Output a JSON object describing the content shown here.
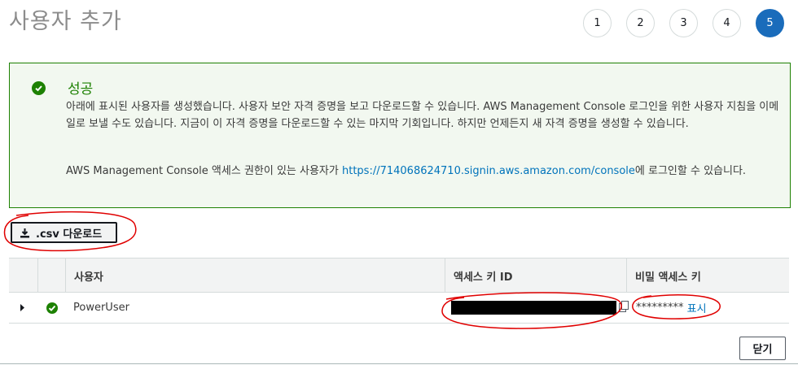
{
  "page": {
    "title": "사용자 추가"
  },
  "steps": [
    {
      "label": "1"
    },
    {
      "label": "2"
    },
    {
      "label": "3"
    },
    {
      "label": "4"
    },
    {
      "label": "5"
    }
  ],
  "alert": {
    "title": "성공",
    "body": "아래에 표시된 사용자를 생성했습니다. 사용자 보안 자격 증명을 보고 다운로드할 수 있습니다. AWS Management Console 로그인을 위한 사용자 지침을 이메일로 보낼 수도 있습니다. 지금이 이 자격 증명을 다운로드할 수 있는 마지막 기회입니다. 하지만 언제든지 새 자격 증명을 생성할 수 있습니다.",
    "console_prefix": "AWS Management Console 액세스 권한이 있는 사용자가 ",
    "console_link": "https://714068624710.signin.aws.amazon.com/console",
    "console_suffix": "에 로그인할 수 있습니다.",
    "color": "#1d8102"
  },
  "toolbar": {
    "csv_label": ".csv 다운로드"
  },
  "table": {
    "headers": {
      "user": "사용자",
      "access_key_id": "액세스 키 ID",
      "secret_key": "비밀 액세스 키"
    },
    "rows": [
      {
        "user": "PowerUser",
        "access_key_id": "",
        "secret_masked": "*********",
        "show_label": "표시"
      }
    ]
  },
  "footer": {
    "close_label": "닫기"
  },
  "colors": {
    "accent": "#1a6cbb",
    "success": "#1d8102",
    "annotation": "#e00000"
  }
}
